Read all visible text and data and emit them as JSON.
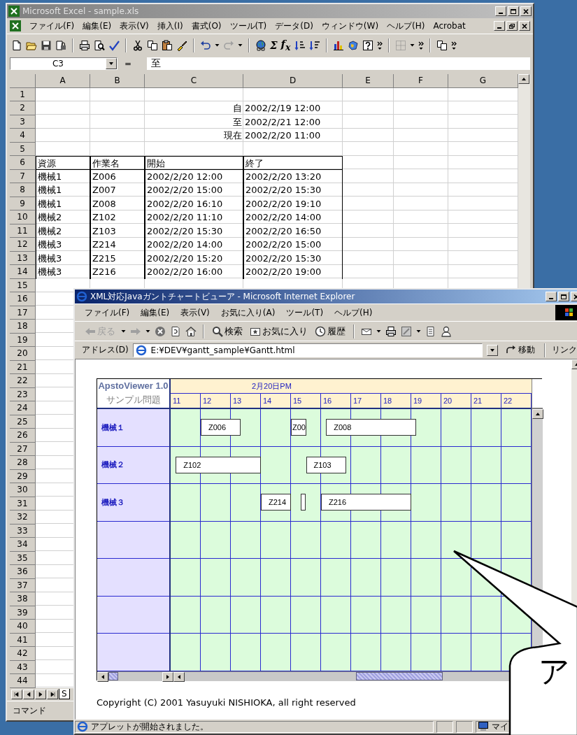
{
  "excel": {
    "title": "Microsoft Excel - sample.xls",
    "menus": [
      "ファイル(F)",
      "編集(E)",
      "表示(V)",
      "挿入(I)",
      "書式(O)",
      "ツール(T)",
      "データ(D)",
      "ウィンドウ(W)",
      "ヘルプ(H)",
      "Acrobat"
    ],
    "toolbar_glyphs": [
      "Σ",
      "f$_{x}$"
    ],
    "name_box": "C3",
    "formula_sign": "=",
    "formula": "至",
    "columns": [
      "A",
      "B",
      "C",
      "D",
      "E",
      "F",
      "G"
    ],
    "rows": [
      {
        "header": "1",
        "kind": "plain"
      },
      {
        "header": "2",
        "kind": "plain",
        "cells": {
          "c": "自",
          "d": "2002/2/19 12:00"
        }
      },
      {
        "header": "3",
        "kind": "plain",
        "cells": {
          "c": "至",
          "d": "2002/2/21 12:00"
        }
      },
      {
        "header": "4",
        "kind": "plain",
        "cells": {
          "c": "現在",
          "d": "2002/2/20 11:00"
        }
      },
      {
        "header": "5",
        "kind": "plain"
      },
      {
        "header": "6",
        "kind": "header",
        "cells": {
          "a": "資源",
          "b": "作業名",
          "c": "開始",
          "d": "終了"
        }
      },
      {
        "header": "7",
        "kind": "table",
        "cells": {
          "a": "機械1",
          "b": "Z006",
          "c": "2002/2/20 12:00",
          "d": "2002/2/20 13:20"
        }
      },
      {
        "header": "8",
        "kind": "table",
        "cells": {
          "a": "機械1",
          "b": "Z007",
          "c": "2002/2/20 15:00",
          "d": "2002/2/20 15:30"
        }
      },
      {
        "header": "9",
        "kind": "table",
        "cells": {
          "a": "機械1",
          "b": "Z008",
          "c": "2002/2/20 16:10",
          "d": "2002/2/20 19:10"
        }
      },
      {
        "header": "10",
        "kind": "table",
        "cells": {
          "a": "機械2",
          "b": "Z102",
          "c": "2002/2/20 11:10",
          "d": "2002/2/20 14:00"
        }
      },
      {
        "header": "11",
        "kind": "table",
        "cells": {
          "a": "機械2",
          "b": "Z103",
          "c": "2002/2/20 15:30",
          "d": "2002/2/20 16:50"
        }
      },
      {
        "header": "12",
        "kind": "table",
        "cells": {
          "a": "機械3",
          "b": "Z214",
          "c": "2002/2/20 14:00",
          "d": "2002/2/20 15:00"
        }
      },
      {
        "header": "13",
        "kind": "table",
        "cells": {
          "a": "機械3",
          "b": "Z215",
          "c": "2002/2/20 15:20",
          "d": "2002/2/20 15:30"
        }
      },
      {
        "header": "14",
        "kind": "table",
        "cells": {
          "a": "機械3",
          "b": "Z216",
          "c": "2002/2/20 16:00",
          "d": "2002/2/20 19:00"
        }
      },
      {
        "header": "15",
        "kind": "plain"
      },
      {
        "header": "16",
        "kind": "plain"
      },
      {
        "header": "17",
        "kind": "plain"
      },
      {
        "header": "18",
        "kind": "plain"
      },
      {
        "header": "19",
        "kind": "plain"
      },
      {
        "header": "20",
        "kind": "plain"
      },
      {
        "header": "21",
        "kind": "plain"
      },
      {
        "header": "22",
        "kind": "plain"
      },
      {
        "header": "23",
        "kind": "plain"
      },
      {
        "header": "24",
        "kind": "plain"
      },
      {
        "header": "25",
        "kind": "plain"
      },
      {
        "header": "26",
        "kind": "plain"
      },
      {
        "header": "27",
        "kind": "plain"
      },
      {
        "header": "28",
        "kind": "plain"
      },
      {
        "header": "29",
        "kind": "plain"
      },
      {
        "header": "30",
        "kind": "plain"
      },
      {
        "header": "31",
        "kind": "plain"
      },
      {
        "header": "32",
        "kind": "plain"
      },
      {
        "header": "33",
        "kind": "plain"
      },
      {
        "header": "34",
        "kind": "plain"
      },
      {
        "header": "35",
        "kind": "plain"
      },
      {
        "header": "36",
        "kind": "plain"
      },
      {
        "header": "37",
        "kind": "plain"
      },
      {
        "header": "38",
        "kind": "plain"
      },
      {
        "header": "39",
        "kind": "plain"
      },
      {
        "header": "40",
        "kind": "plain"
      },
      {
        "header": "41",
        "kind": "plain"
      },
      {
        "header": "42",
        "kind": "plain"
      },
      {
        "header": "43",
        "kind": "plain"
      },
      {
        "header": "44",
        "kind": "plain"
      }
    ],
    "sheet_tab": "S",
    "status": "コマンド"
  },
  "ie": {
    "title": "XML対応Javaガントチャートビューア - Microsoft Internet Explorer",
    "menus": [
      "ファイル(F)",
      "編集(E)",
      "表示(V)",
      "お気に入り(A)",
      "ツール(T)",
      "ヘルプ(H)"
    ],
    "toolbar": [
      {
        "kind": "back",
        "label": "戻る",
        "disabled": true
      },
      {
        "kind": "search",
        "label": "検索",
        "disabled": false
      },
      {
        "kind": "favorites",
        "label": "お気に入り",
        "disabled": false
      },
      {
        "kind": "history",
        "label": "履歴",
        "disabled": false
      }
    ],
    "address_label": "アドレス(D)",
    "address": "E:¥DEV¥gantt_sample¥Gantt.html",
    "go": "移動",
    "links": "リンク",
    "copyright": "Copyright (C) 2001 Yasuyuki NISHIOKA, all right reserved",
    "status": "アプレットが開始されました。",
    "zone": "マイ"
  },
  "gantt": {
    "title": "ApstoViewer 1.0",
    "problem": "サンプル問題",
    "date": "2月20日PM",
    "hours": [
      "11",
      "12",
      "13",
      "14",
      "15",
      "16",
      "17",
      "18",
      "19",
      "20",
      "21",
      "22"
    ],
    "resources": [
      {
        "name": "機械１",
        "tasks": [
          {
            "kind": "bar",
            "label": "Z006"
          },
          {
            "kind": "bar",
            "label": "Z00"
          },
          {
            "kind": "bar",
            "label": "Z008"
          }
        ]
      },
      {
        "name": "機械２",
        "tasks": [
          {
            "kind": "bar",
            "label": "Z102"
          },
          {
            "kind": "bar",
            "label": "Z103"
          }
        ]
      },
      {
        "name": "機械３",
        "tasks": [
          {
            "kind": "bar",
            "label": "Z214"
          },
          {
            "kind": "bar"
          },
          {
            "kind": "bar",
            "label": "Z216"
          }
        ]
      }
    ]
  },
  "callout": {
    "text": "ア"
  }
}
